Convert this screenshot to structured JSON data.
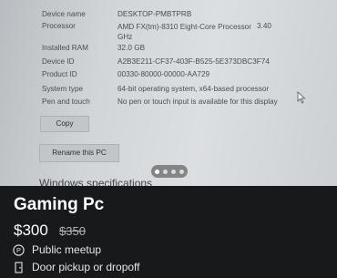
{
  "specs": {
    "device_name": {
      "label": "Device name",
      "value": "DESKTOP-PMBTPRB"
    },
    "processor": {
      "label": "Processor",
      "value": "AMD FX(tm)-8310 Eight-Core Processor",
      "value2": "GHz",
      "speed": "3.40"
    },
    "ram": {
      "label": "Installed RAM",
      "value": "32.0 GB"
    },
    "device_id": {
      "label": "Device ID",
      "value": "A2B3E211-CF37-403F-B525-5E373DBC3F74"
    },
    "product_id": {
      "label": "Product ID",
      "value": "00330-80000-00000-AA729"
    },
    "system_type": {
      "label": "System type",
      "value": "64-bit operating system, x64-based processor"
    },
    "pen_touch": {
      "label": "Pen and touch",
      "value": "No pen or touch input is available for this display"
    }
  },
  "buttons": {
    "copy": "Copy",
    "rename": "Rename this PC"
  },
  "section_heading": "Windows specifications",
  "listing": {
    "title": "Gaming Pc",
    "price": "$300",
    "original_price": "$350",
    "meetup": "Public meetup",
    "delivery": "Door pickup or dropoff"
  }
}
